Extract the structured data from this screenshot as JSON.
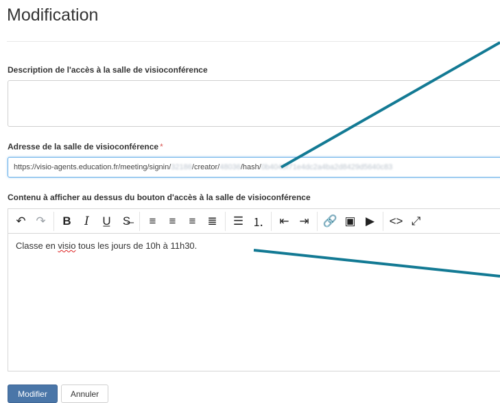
{
  "page": {
    "title": "Modification"
  },
  "description_field": {
    "label": "Description de l'accès à la salle de visioconférence",
    "value": ""
  },
  "url_field": {
    "label": "Adresse de la salle de visioconférence",
    "required_mark": "*",
    "segments": [
      {
        "text": "https://visio-agents.education.fr/meeting/signin/",
        "blurred": false
      },
      {
        "text": "32186",
        "blurred": true
      },
      {
        "text": "/creator/",
        "blurred": false
      },
      {
        "text": "48036",
        "blurred": true
      },
      {
        "text": "/hash/",
        "blurred": false
      },
      {
        "text": "0b4040f71e4dc2a4ba2d8429d5640c83",
        "blurred": true
      }
    ]
  },
  "editor_field": {
    "label": "Contenu à afficher au dessus du bouton d'accès à la salle de visioconférence",
    "content": {
      "before": "Classe en ",
      "misspelled": "visio",
      "after": " tous les jours de 10h à 11h30."
    }
  },
  "toolbar": {
    "groups": [
      [
        {
          "name": "undo-icon",
          "glyph": "↶"
        },
        {
          "name": "redo-icon",
          "glyph": "↷",
          "dim": true
        }
      ],
      [
        {
          "name": "bold-icon",
          "glyph": "B",
          "style": "bold"
        },
        {
          "name": "italic-icon",
          "glyph": "I",
          "style": "serif"
        },
        {
          "name": "underline-icon",
          "glyph": "U̲"
        },
        {
          "name": "strikethrough-icon",
          "glyph": "S̶"
        }
      ],
      [
        {
          "name": "align-left-icon",
          "glyph": "≡"
        },
        {
          "name": "align-center-icon",
          "glyph": "≡"
        },
        {
          "name": "align-right-icon",
          "glyph": "≡"
        },
        {
          "name": "align-justify-icon",
          "glyph": "≣"
        }
      ],
      [
        {
          "name": "bullet-list-icon",
          "glyph": "☰"
        },
        {
          "name": "numbered-list-icon",
          "glyph": "⒈"
        }
      ],
      [
        {
          "name": "outdent-icon",
          "glyph": "⇤"
        },
        {
          "name": "indent-icon",
          "glyph": "⇥"
        }
      ],
      [
        {
          "name": "link-icon",
          "glyph": "🔗"
        },
        {
          "name": "image-icon",
          "glyph": "▣"
        },
        {
          "name": "media-icon",
          "glyph": "▶"
        }
      ],
      [
        {
          "name": "code-icon",
          "glyph": "<>"
        },
        {
          "name": "fullscreen-icon",
          "glyph": "⤢"
        }
      ]
    ]
  },
  "buttons": {
    "submit_label": "Modifier",
    "cancel_label": "Annuler"
  },
  "colors": {
    "primary": "#4a76a8",
    "arrow": "#137a94",
    "required": "#d9534f"
  }
}
